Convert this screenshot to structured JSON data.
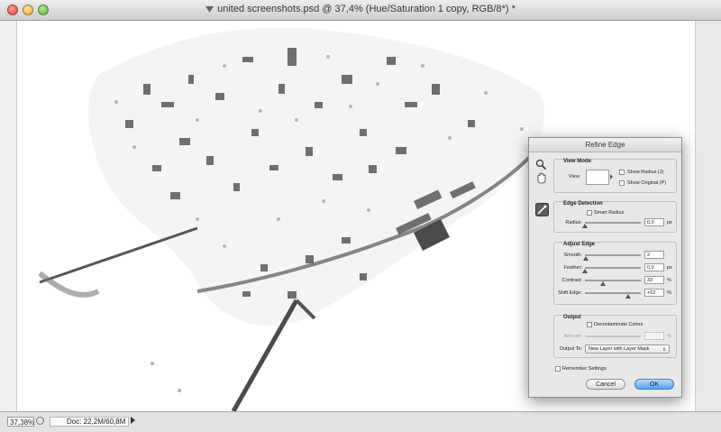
{
  "window": {
    "title": "united screenshots.psd @ 37,4% (Hue/Saturation 1 copy, RGB/8*) *"
  },
  "statusbar": {
    "zoom": "37,38%",
    "doc_info": "Doc: 22,2M/60,8M"
  },
  "dialog": {
    "title": "Refine Edge",
    "tools": [
      "zoom-tool",
      "hand-tool",
      "refine-radius-tool"
    ],
    "view_mode": {
      "title": "View Mode",
      "view_label": "View:",
      "show_radius": "Show Radius (J)",
      "show_original": "Show Original (P)"
    },
    "edge_detection": {
      "title": "Edge Detection",
      "smart_radius": "Smart Radius",
      "radius_label": "Radius:",
      "radius_value": "0,0",
      "radius_unit": "px"
    },
    "adjust_edge": {
      "title": "Adjust Edge",
      "smooth_label": "Smooth:",
      "smooth_value": "2",
      "feather_label": "Feather:",
      "feather_value": "0,0",
      "feather_unit": "px",
      "contrast_label": "Contrast:",
      "contrast_value": "33",
      "contrast_unit": "%",
      "shift_label": "Shift Edge:",
      "shift_value": "+53",
      "shift_unit": "%"
    },
    "output": {
      "title": "Output",
      "decontaminate": "Decontaminate Colors",
      "amount_label": "Amount:",
      "amount_unit": "%",
      "output_to_label": "Output To:",
      "output_to_value": "New Layer with Layer Mask"
    },
    "remember": "Remember Settings",
    "cancel": "Cancel",
    "ok": "OK"
  },
  "colors": {
    "ok_button": "#5aa3ef",
    "canvas_bg": "#ffffff"
  }
}
